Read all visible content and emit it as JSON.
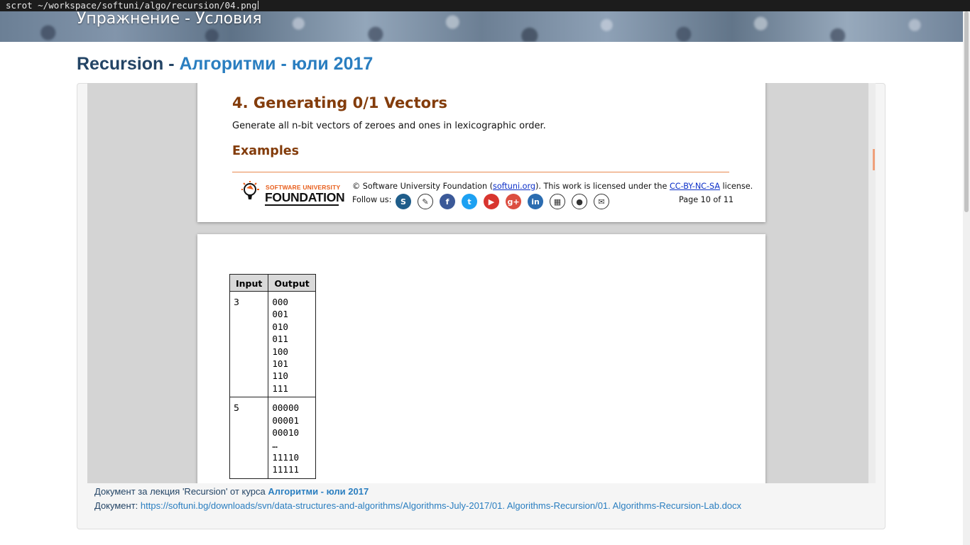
{
  "terminal": {
    "command": "scrot ~/workspace/softuni/algo/recursion/04.png"
  },
  "banner": {
    "title": "Упражнение - Условия"
  },
  "heading": {
    "part1": "Recursion",
    "separator": " - ",
    "part2": "Алгоритми - юли 2017"
  },
  "document": {
    "page1": {
      "problem_title": "4. Generating 0/1 Vectors",
      "description": "Generate all n-bit vectors of zeroes and ones in lexicographic order.",
      "examples_heading": "Examples",
      "footer": {
        "logo_line1": "SOFTWARE UNIVERSITY",
        "logo_line2": "FOUNDATION",
        "copyright_pre": "© Software University Foundation (",
        "copyright_link": "softuni.org",
        "copyright_mid": "). This work is licensed under the ",
        "license_link": "CC-BY-NC-SA",
        "copyright_post": " license.",
        "follow_label": "Follow us:",
        "page_number": "Page 10 of 11",
        "social_icons": [
          {
            "name": "softuni-icon",
            "color": "#1f5d8a",
            "glyph": "S"
          },
          {
            "name": "forum-icon",
            "color": "#ffffff",
            "glyph": "✎"
          },
          {
            "name": "facebook-icon",
            "color": "#3b5998",
            "glyph": "f"
          },
          {
            "name": "twitter-icon",
            "color": "#1da1f2",
            "glyph": "t"
          },
          {
            "name": "youtube-icon",
            "color": "#d8352f",
            "glyph": "▶"
          },
          {
            "name": "googleplus-icon",
            "color": "#dc4e41",
            "glyph": "g+"
          },
          {
            "name": "linkedin-icon",
            "color": "#2b6cb0",
            "glyph": "in"
          },
          {
            "name": "slideshare-icon",
            "color": "#ffffff",
            "glyph": "▦"
          },
          {
            "name": "github-icon",
            "color": "#ffffff",
            "glyph": "●"
          },
          {
            "name": "email-icon",
            "color": "#ffffff",
            "glyph": "✉"
          }
        ]
      }
    },
    "page2": {
      "table": {
        "headers": [
          "Input",
          "Output"
        ],
        "rows": [
          {
            "input": "3",
            "output": "000\n001\n010\n011\n100\n101\n110\n111"
          },
          {
            "input": "5",
            "output": "00000\n00001\n00010\n…\n11110\n11111"
          }
        ]
      }
    }
  },
  "meta": {
    "line1_pre": "Документ за лекция 'Recursion' от курса ",
    "line1_course": "Алгоритми - юли 2017",
    "line2_label": "Документ: ",
    "line2_url": "https://softuni.bg/downloads/svn/data-structures-and-algorithms/Algorithms-July-2017/01. Algorithms-Recursion/01. Algorithms-Recursion-Lab.docx"
  }
}
